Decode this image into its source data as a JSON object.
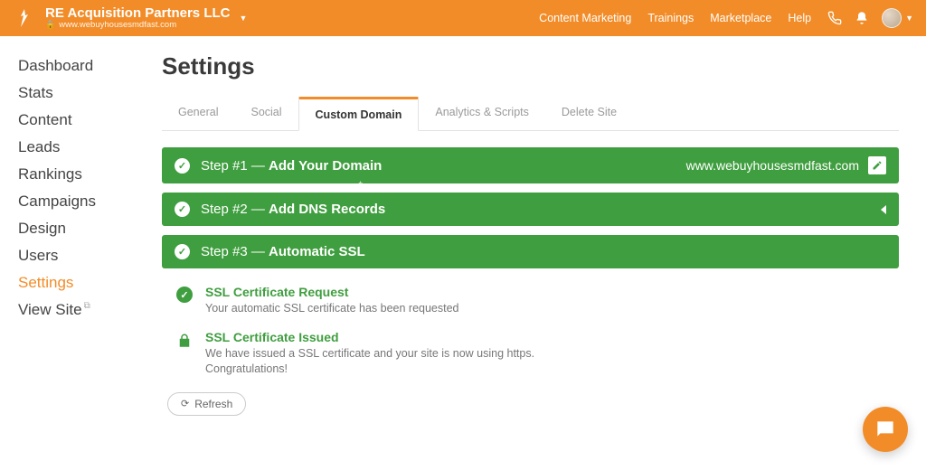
{
  "brand": {
    "org_name": "RE Acquisition Partners LLC",
    "org_domain": "www.webuyhousesmdfast.com"
  },
  "topnav": {
    "links": [
      "Content Marketing",
      "Trainings",
      "Marketplace",
      "Help"
    ]
  },
  "sidebar": {
    "items": [
      {
        "label": "Dashboard"
      },
      {
        "label": "Stats"
      },
      {
        "label": "Content"
      },
      {
        "label": "Leads"
      },
      {
        "label": "Rankings"
      },
      {
        "label": "Campaigns"
      },
      {
        "label": "Design"
      },
      {
        "label": "Users"
      },
      {
        "label": "Settings",
        "active": true
      },
      {
        "label": "View Site",
        "external": true
      }
    ]
  },
  "page": {
    "title": "Settings"
  },
  "tabs": {
    "items": [
      {
        "label": "General"
      },
      {
        "label": "Social"
      },
      {
        "label": "Custom Domain",
        "active": true
      },
      {
        "label": "Analytics & Scripts"
      },
      {
        "label": "Delete Site"
      }
    ]
  },
  "steps": {
    "step1": {
      "prefix": "Step #1 — ",
      "title": "Add Your Domain",
      "domain_value": "www.webuyhousesmdfast.com"
    },
    "step2": {
      "prefix": "Step #2 — ",
      "title": "Add DNS Records"
    },
    "step3": {
      "prefix": "Step #3 — ",
      "title": "Automatic SSL"
    }
  },
  "ssl": {
    "request": {
      "heading": "SSL Certificate Request",
      "sub": "Your automatic SSL certificate has been requested"
    },
    "issued": {
      "heading": "SSL Certificate Issued",
      "sub": "We have issued a SSL certificate and your site is now using https. Congratulations!"
    },
    "refresh_label": "Refresh"
  },
  "colors": {
    "accent": "#f28c28",
    "step_green": "#3f9e3f"
  }
}
